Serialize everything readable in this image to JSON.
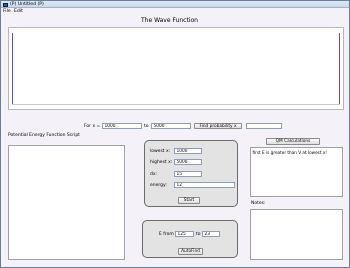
{
  "window": {
    "title": "(P) Untitled (P)",
    "menu": [
      "File",
      "Edit"
    ]
  },
  "heading": "The Wave Function",
  "range_bar": {
    "for_label": "For x =",
    "x_from": "1000",
    "to_label": "to",
    "x_to": "5000",
    "find_probability_label": "Find probability x",
    "probability_value": ""
  },
  "script_section": {
    "label": "Potential Energy Function Script",
    "content": ""
  },
  "parameters": {
    "lowest_label": "lowest x:",
    "lowest_value": "1000",
    "highest_label": "highest x:",
    "highest_value": "5000",
    "dx_label": "dx:",
    "dx_value": "15",
    "energy_label": "energy:",
    "energy_value": "12",
    "start_label": "Start"
  },
  "qm": {
    "button_label": "QM Calculations",
    "output": "first E is greater than V at lowest x!"
  },
  "notes": {
    "label": "Notes:",
    "content": ""
  },
  "autofind": {
    "from_label": "E from",
    "from_value": "125",
    "to_label": "to",
    "to_value": "23",
    "button_label": "AutoFind"
  },
  "colors": {
    "window_bg": "#f4f1f8",
    "plot_axis": "#5b4fbf",
    "panel_bg": "#e3e3e3"
  }
}
